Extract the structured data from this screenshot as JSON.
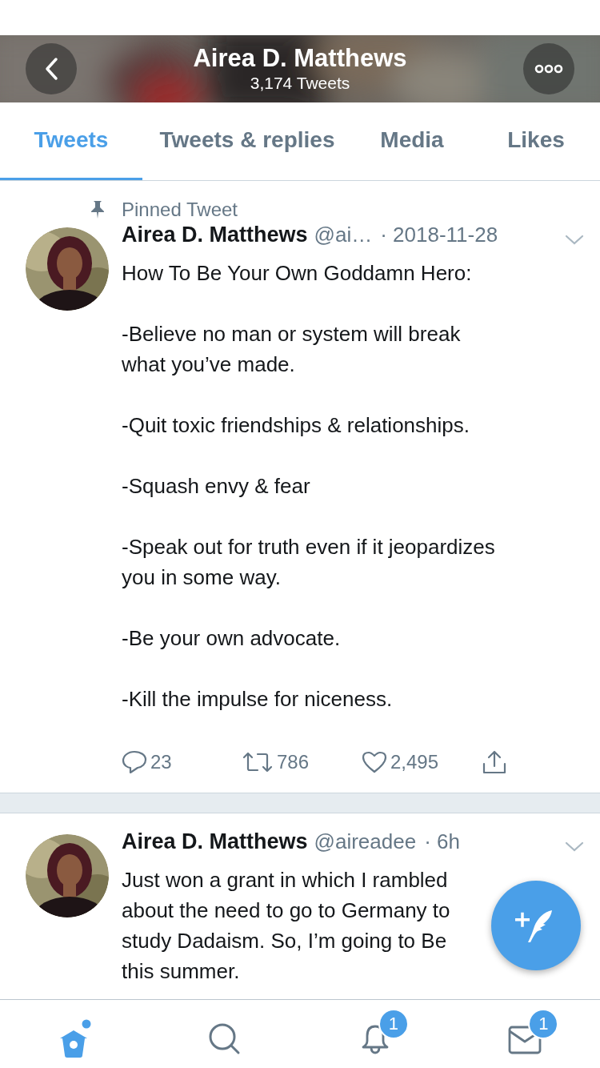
{
  "header": {
    "title": "Airea D. Matthews",
    "subtitle": "3,174 Tweets"
  },
  "tabs": [
    {
      "label": "Tweets",
      "selected": true
    },
    {
      "label": "Tweets & replies",
      "selected": false
    },
    {
      "label": "Media",
      "selected": false
    },
    {
      "label": "Likes",
      "selected": false
    }
  ],
  "tweets": [
    {
      "pinned": true,
      "pinned_label": "Pinned Tweet",
      "name": "Airea D. Matthews",
      "handle": "@ai…",
      "time": "· 2018-11-28",
      "paragraphs": [
        [
          "How To Be Your Own Goddamn Hero:"
        ],
        [
          "-Believe no man or system will break",
          "what you’ve made."
        ],
        [
          "-Quit toxic friendships & relationships."
        ],
        [
          "-Squash envy & fear"
        ],
        [
          "-Speak out for truth even if it jeopardizes",
          "you in some way."
        ],
        [
          "-Be your own advocate."
        ],
        [
          "-Kill the impulse for niceness."
        ]
      ],
      "replies": "23",
      "retweets": "786",
      "likes": "2,495"
    },
    {
      "pinned": false,
      "name": "Airea D. Matthews",
      "handle": "@aireadee",
      "time": "· 6h",
      "paragraphs": [
        [
          "Just won a grant in which I rambled",
          "about the need to go to Germany to",
          "study Dadaism. So, I’m going to Be",
          "this summer."
        ]
      ]
    }
  ],
  "nav": [
    {
      "kind": "home",
      "selected": true,
      "dot": true
    },
    {
      "kind": "search",
      "selected": false
    },
    {
      "kind": "notifications",
      "selected": false,
      "badge": "1"
    },
    {
      "kind": "messages",
      "selected": false,
      "badge": "1"
    }
  ]
}
